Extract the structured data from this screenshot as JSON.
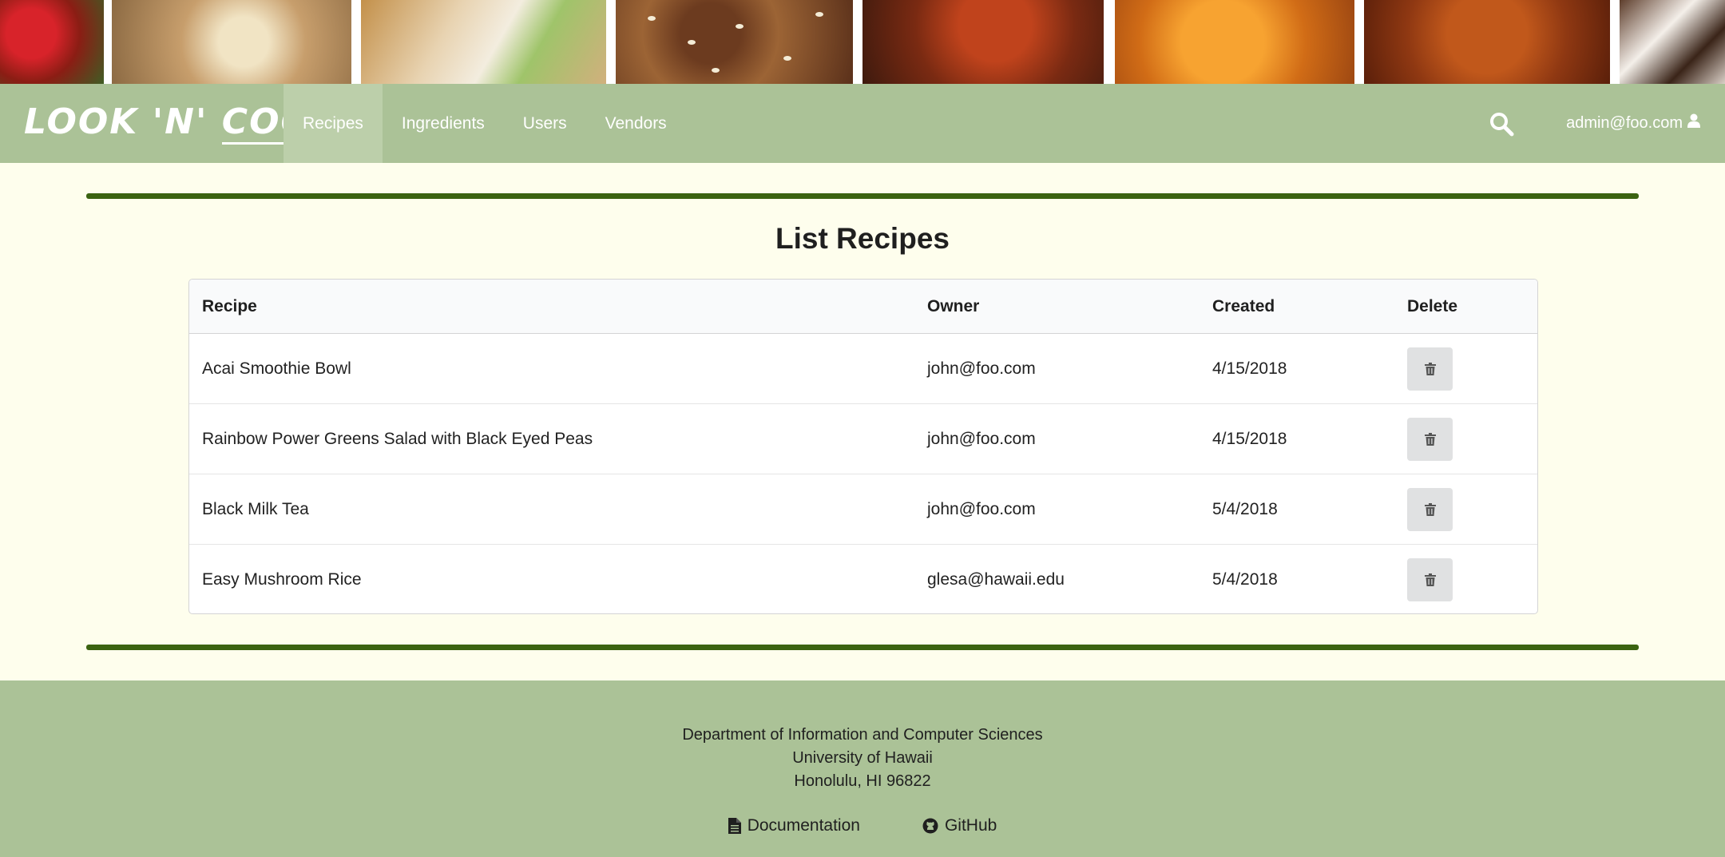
{
  "brand": {
    "logo_text": "LOOK 'N' COOK",
    "logo_part1": "LOOK ",
    "logo_part2": "'N'",
    "logo_part3": "COOK"
  },
  "nav": {
    "links": [
      {
        "label": "Recipes",
        "active": true
      },
      {
        "label": "Ingredients",
        "active": false
      },
      {
        "label": "Users",
        "active": false
      },
      {
        "label": "Vendors",
        "active": false
      }
    ],
    "search_icon": "search-icon",
    "user_email": "admin@foo.com",
    "user_icon": "user-icon"
  },
  "page": {
    "title": "List Recipes"
  },
  "table": {
    "headers": [
      "Recipe",
      "Owner",
      "Created",
      "Delete"
    ],
    "rows": [
      {
        "recipe": "Acai Smoothie Bowl",
        "owner": "john@foo.com",
        "created": "4/15/2018"
      },
      {
        "recipe": "Rainbow Power Greens Salad with Black Eyed Peas",
        "owner": "john@foo.com",
        "created": "4/15/2018"
      },
      {
        "recipe": "Black Milk Tea",
        "owner": "john@foo.com",
        "created": "5/4/2018"
      },
      {
        "recipe": "Easy Mushroom Rice",
        "owner": "glesa@hawaii.edu",
        "created": "5/4/2018"
      }
    ],
    "delete_icon": "trash-icon"
  },
  "footer": {
    "line1": "Department of Information and Computer Sciences",
    "line2": "University of Hawaii",
    "line3": "Honolulu, HI 96822",
    "doc_label": "Documentation",
    "github_label": "GitHub"
  },
  "colors": {
    "background": "#fefeed",
    "navbar": "#abc297",
    "nav_active": "#bccfaa",
    "rule": "#3b6311",
    "button": "#e0e1e2"
  }
}
